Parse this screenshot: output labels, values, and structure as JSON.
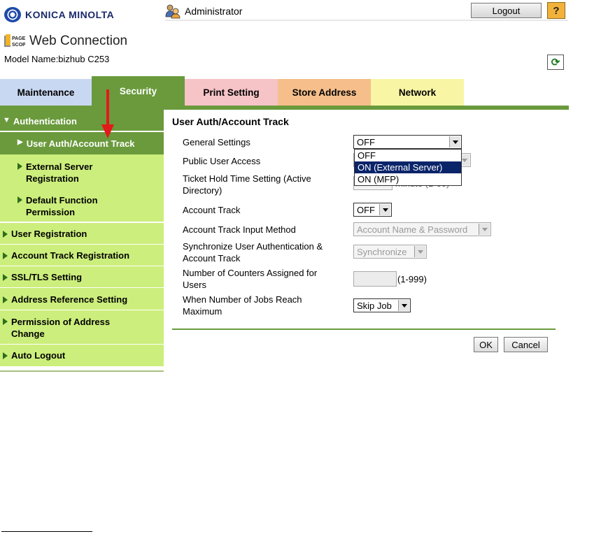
{
  "header": {
    "brand": "KONICA MINOLTA",
    "user": "Administrator",
    "logout_label": "Logout",
    "help_label": "?",
    "app_title": "Web Connection",
    "app_logo_text": "PAGE SCOPE",
    "model_name": "Model Name:bizhub C253"
  },
  "tabs": [
    {
      "label": "Maintenance",
      "color": "#c9d8f2"
    },
    {
      "label": "Security",
      "color": "#6a9a3c",
      "active": true
    },
    {
      "label": "Print Setting",
      "color": "#f6c3c6"
    },
    {
      "label": "Store Address",
      "color": "#f6be8a"
    },
    {
      "label": "Network",
      "color": "#f8f6a4"
    }
  ],
  "sidebar": {
    "items": [
      {
        "label": "Authentication",
        "expanded": true
      },
      {
        "label": "User Auth/Account Track",
        "selected": true
      },
      {
        "label": "External Server Registration"
      },
      {
        "label": "Default Function Permission"
      },
      {
        "label": "User Registration"
      },
      {
        "label": "Account Track Registration"
      },
      {
        "label": "SSL/TLS Setting"
      },
      {
        "label": "Address Reference Setting"
      },
      {
        "label": "Permission of Address Change"
      },
      {
        "label": "Auto Logout"
      }
    ]
  },
  "main": {
    "title": "User Auth/Account Track",
    "fields": [
      {
        "label": "General Settings",
        "value": "OFF"
      },
      {
        "label": "Public User Access",
        "value": ""
      },
      {
        "label": "Ticket Hold Time Setting (Active Directory)",
        "suffix": "minute (1-60)"
      },
      {
        "label": "Account Track",
        "value": "OFF"
      },
      {
        "label": "Account Track Input Method",
        "value": "Account Name & Password"
      },
      {
        "label": "Synchronize User Authentication & Account Track",
        "value": "Synchronize"
      },
      {
        "label": "Number of Counters Assigned for Users",
        "value": "",
        "suffix": "(1-999)"
      },
      {
        "label": "When Number of Jobs Reach Maximum",
        "value": "Skip Job"
      }
    ],
    "dropdown_options": [
      "OFF",
      "ON (External Server)",
      "ON (MFP)"
    ],
    "dropdown_highlighted": "ON (External Server)",
    "ok_label": "OK",
    "cancel_label": "Cancel"
  },
  "colors": {
    "sidebar_light": "#ccee7c",
    "sidebar_dark": "#6a9a3c",
    "annotation_arrow": "#e21a1a",
    "highlight": "#0a246a"
  }
}
